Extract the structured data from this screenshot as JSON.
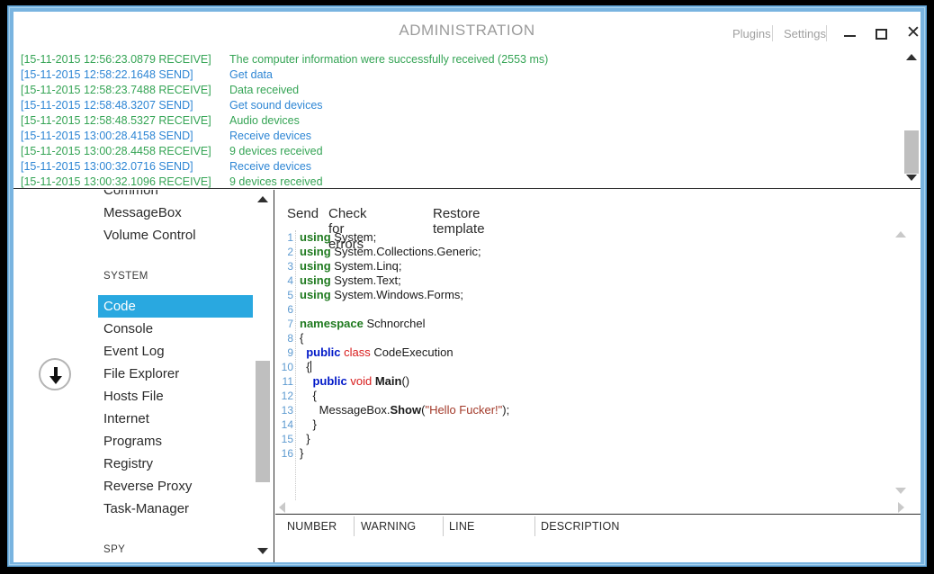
{
  "window": {
    "title": "ADMINISTRATION",
    "links": [
      {
        "label": "Plugins",
        "name": "plugins-link"
      },
      {
        "label": "Settings",
        "name": "settings-link"
      }
    ],
    "controls": {
      "minimize": "minimize-button",
      "maximize": "maximize-button",
      "close": "close-button"
    }
  },
  "log": {
    "entries": [
      {
        "timestamp": "[15-11-2015 12:56:23.0879 RECEIVE]",
        "message": "The computer information were successfully received (2553 ms)",
        "direction": "receive"
      },
      {
        "timestamp": "[15-11-2015 12:58:22.1648 SEND]",
        "message": "Get data",
        "direction": "send"
      },
      {
        "timestamp": "[15-11-2015 12:58:23.7488 RECEIVE]",
        "message": "Data received",
        "direction": "receive"
      },
      {
        "timestamp": "[15-11-2015 12:58:48.3207 SEND]",
        "message": "Get sound devices",
        "direction": "send"
      },
      {
        "timestamp": "[15-11-2015 12:58:48.5327 RECEIVE]",
        "message": "Audio devices",
        "direction": "receive"
      },
      {
        "timestamp": "[15-11-2015 13:00:28.4158 SEND]",
        "message": "Receive devices",
        "direction": "send"
      },
      {
        "timestamp": "[15-11-2015 13:00:28.4458 RECEIVE]",
        "message": "9 devices received",
        "direction": "receive"
      },
      {
        "timestamp": "[15-11-2015 13:00:32.0716 SEND]",
        "message": "Receive devices",
        "direction": "send"
      },
      {
        "timestamp": "[15-11-2015 13:00:32.1096 RECEIVE]",
        "message": "9 devices received",
        "direction": "receive"
      }
    ]
  },
  "sidebar": {
    "top_items": [
      {
        "label": "Common",
        "selected": false
      },
      {
        "label": "MessageBox",
        "selected": false
      },
      {
        "label": "Volume Control",
        "selected": false
      }
    ],
    "sections": [
      {
        "header": "SYSTEM",
        "items": [
          {
            "label": "Code",
            "selected": true
          },
          {
            "label": "Console",
            "selected": false
          },
          {
            "label": "Event Log",
            "selected": false
          },
          {
            "label": "File Explorer",
            "selected": false
          },
          {
            "label": "Hosts File",
            "selected": false
          },
          {
            "label": "Internet",
            "selected": false
          },
          {
            "label": "Programs",
            "selected": false
          },
          {
            "label": "Registry",
            "selected": false
          },
          {
            "label": "Reverse Proxy",
            "selected": false
          },
          {
            "label": "Task-Manager",
            "selected": false
          }
        ]
      },
      {
        "header": "SPY",
        "items": []
      }
    ],
    "scroll_down_button": "scroll-down-button"
  },
  "editor": {
    "toolbar": [
      {
        "label": "Send",
        "name": "send-button"
      },
      {
        "label": "Check for errors",
        "name": "check-for-errors-button"
      },
      {
        "label": "Restore template",
        "name": "restore-template-button"
      }
    ],
    "line_numbers": [
      "1",
      "2",
      "3",
      "4",
      "5",
      "6",
      "7",
      "8",
      "9",
      "10",
      "11",
      "12",
      "13",
      "14",
      "15",
      "16"
    ],
    "code_lines": [
      {
        "n": 1,
        "tokens": [
          {
            "t": "using",
            "c": "kw-green"
          },
          {
            "t": " System;",
            "c": ""
          }
        ]
      },
      {
        "n": 2,
        "tokens": [
          {
            "t": "using",
            "c": "kw-green"
          },
          {
            "t": " System.Collections.Generic;",
            "c": ""
          }
        ]
      },
      {
        "n": 3,
        "tokens": [
          {
            "t": "using",
            "c": "kw-green"
          },
          {
            "t": " System.Linq;",
            "c": ""
          }
        ]
      },
      {
        "n": 4,
        "tokens": [
          {
            "t": "using",
            "c": "kw-green"
          },
          {
            "t": " System.Text;",
            "c": ""
          }
        ]
      },
      {
        "n": 5,
        "tokens": [
          {
            "t": "using",
            "c": "kw-green"
          },
          {
            "t": " System.Windows.Forms;",
            "c": ""
          }
        ]
      },
      {
        "n": 6,
        "tokens": []
      },
      {
        "n": 7,
        "tokens": [
          {
            "t": "namespace",
            "c": "kw-green"
          },
          {
            "t": " Schnorchel",
            "c": ""
          }
        ]
      },
      {
        "n": 8,
        "tokens": [
          {
            "t": "{",
            "c": ""
          }
        ]
      },
      {
        "n": 9,
        "tokens": [
          {
            "t": "  ",
            "c": ""
          },
          {
            "t": "public",
            "c": "kw-blue"
          },
          {
            "t": " ",
            "c": ""
          },
          {
            "t": "class",
            "c": "kw-red"
          },
          {
            "t": " CodeExecution",
            "c": ""
          }
        ]
      },
      {
        "n": 10,
        "tokens": [
          {
            "t": "  {",
            "c": ""
          }
        ],
        "caret": true
      },
      {
        "n": 11,
        "tokens": [
          {
            "t": "    ",
            "c": ""
          },
          {
            "t": "public",
            "c": "kw-blue"
          },
          {
            "t": " ",
            "c": ""
          },
          {
            "t": "void",
            "c": "kw-red"
          },
          {
            "t": " ",
            "c": ""
          },
          {
            "t": "Main",
            "c": "id-bold"
          },
          {
            "t": "()",
            "c": ""
          }
        ]
      },
      {
        "n": 12,
        "tokens": [
          {
            "t": "    {",
            "c": ""
          }
        ]
      },
      {
        "n": 13,
        "tokens": [
          {
            "t": "      MessageBox.",
            "c": ""
          },
          {
            "t": "Show",
            "c": "id-bold"
          },
          {
            "t": "(",
            "c": ""
          },
          {
            "t": "\"Hello Fucker!\"",
            "c": "str"
          },
          {
            "t": ");",
            "c": ""
          }
        ]
      },
      {
        "n": 14,
        "tokens": [
          {
            "t": "    }",
            "c": ""
          }
        ]
      },
      {
        "n": 15,
        "tokens": [
          {
            "t": "  }",
            "c": ""
          }
        ]
      },
      {
        "n": 16,
        "tokens": [
          {
            "t": "}",
            "c": ""
          }
        ]
      }
    ]
  },
  "error_table": {
    "columns": [
      "NUMBER",
      "WARNING",
      "LINE",
      "DESCRIPTION"
    ],
    "rows": []
  },
  "colors": {
    "accent": "#29a8e0",
    "frame": "#79b4e0",
    "send": "#2e86d4",
    "receive": "#35a455"
  }
}
